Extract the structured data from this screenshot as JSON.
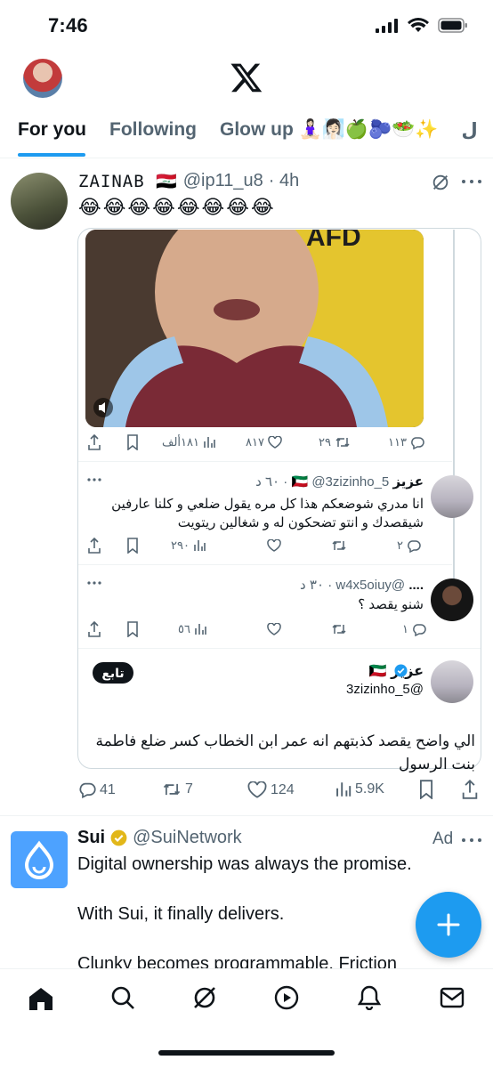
{
  "status": {
    "time": "7:46"
  },
  "tabs": [
    "For you",
    "Following",
    "Glow up 🧘🏻‍♀️🧖🏻‍♀️🍏🫐🥗✨",
    "ل"
  ],
  "post": {
    "display_name": "ZAINAB 🇮🇶",
    "handle": "@ip11_u8",
    "time": "· 4h",
    "text": "😂😂😂😂😂😂😂😂",
    "video_actions": {
      "views": "١٨١ألف",
      "likes": "٨١٧",
      "retweets": "٢٩",
      "replies": "١١٣"
    },
    "replies": [
      {
        "name": "عزيز 🇰🇼",
        "handle": "@3zizinho_5 · ٦٠ د",
        "text": "انا مدري شوضعكم هذا كل مره يقول ضلعي و كلنا عارفين شيقصدك و انتو تضحكون له و شغالين ريتويت",
        "views": "٢٩٠",
        "replies": "٢"
      },
      {
        "name": "....",
        "handle": "@w4x5oiuy · ٣٠ د",
        "text": "شنو يقصد ؟",
        "views": "٥٦",
        "replies": "١"
      }
    ],
    "quoted": {
      "name": "عزيز 🇰🇼",
      "handle": "@3zizinho_5",
      "follow_label": "تابع",
      "text": "الي واضح يقصد كذبتهم انه عمر ابن الخطاب كسر ضلع فاطمة بنت الرسول"
    },
    "stats": {
      "replies": "41",
      "reposts": "7",
      "likes": "124",
      "views": "5.9K"
    }
  },
  "ad": {
    "name": "Sui",
    "handle": "@SuiNetwork",
    "ad_label": "Ad",
    "lines": [
      "Digital ownership was always the promise.",
      "With Sui, it finally delivers.",
      "Clunky becomes programmable. Friction"
    ]
  },
  "colors": {
    "accent": "#1d9bf0",
    "muted": "#536471",
    "sui": "#4da2ff"
  }
}
